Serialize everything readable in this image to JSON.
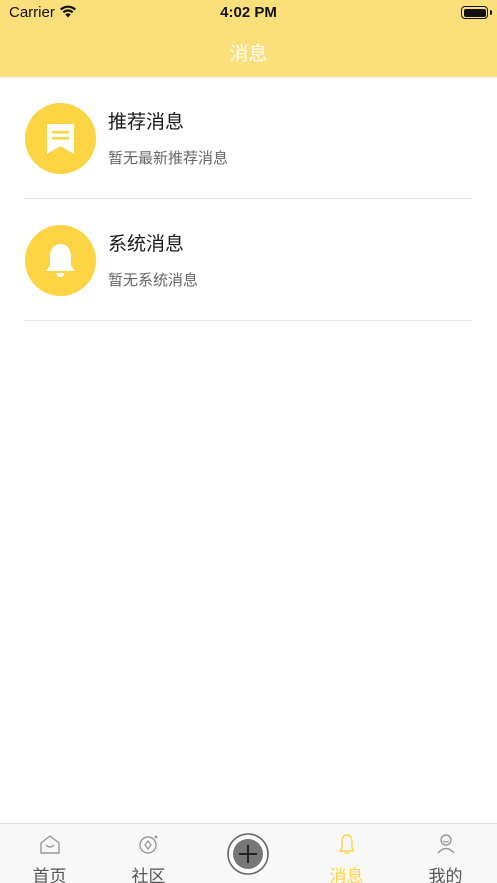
{
  "status_bar": {
    "carrier": "Carrier",
    "time": "4:02 PM"
  },
  "nav": {
    "title": "消息"
  },
  "messages": [
    {
      "title": "推荐消息",
      "subtitle": "暂无最新推荐消息",
      "icon": "bookmark-icon"
    },
    {
      "title": "系统消息",
      "subtitle": "暂无系统消息",
      "icon": "bell-icon"
    }
  ],
  "tabbar": {
    "items": [
      {
        "label": "首页",
        "icon": "home-icon",
        "active": false
      },
      {
        "label": "社区",
        "icon": "community-icon",
        "active": false
      },
      {
        "label": "",
        "icon": "add-icon",
        "active": false
      },
      {
        "label": "消息",
        "icon": "bell-icon",
        "active": true
      },
      {
        "label": "我的",
        "icon": "user-icon",
        "active": false
      }
    ]
  },
  "colors": {
    "nav_bg": "#fadf7a",
    "accent": "#fdd443",
    "tab_inactive": "#555555"
  }
}
